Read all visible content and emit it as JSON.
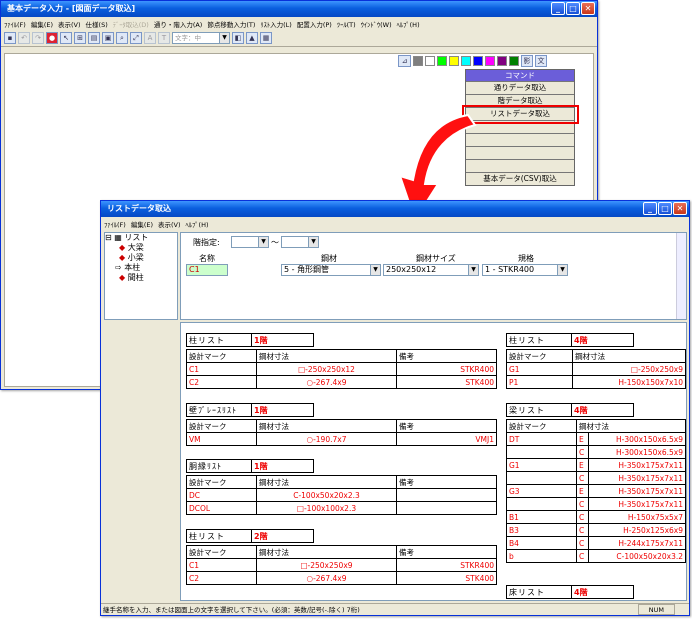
{
  "main_window": {
    "title": "基本データ入力 - [図面データ取込]",
    "menus": [
      "ﾌｧｲﾙ(F)",
      "編集(E)",
      "表示(V)",
      "仕様(S)",
      "ﾃﾞｰﾀ取込(D)",
      "通り・階入力(A)",
      "節点移動入力(T)",
      "ﾘｽﾄ入力(L)",
      "配置入力(P)",
      "ﾂｰﾙ(T)",
      "ｳｲﾝﾄﾞｳ(W)",
      "ﾍﾙﾌﾟ(H)"
    ],
    "disabled_menu": "ﾃﾞｰﾀ取込(D)",
    "text_combo": "文字：中",
    "color_labels": [
      "影",
      "文"
    ],
    "swatches": [
      "#7f7f7f",
      "#ffffff",
      "#00ff00",
      "#ffff00",
      "#00ffff",
      "#0000ff",
      "#ff00ff",
      "#800080",
      "#008000"
    ],
    "command_panel": {
      "header": "コマンド",
      "items": [
        "通りデータ取込",
        "階データ取込",
        "リストデータ取込",
        "",
        "",
        "",
        "",
        "基本データ(CSV)取込"
      ],
      "highlighted": "リストデータ取込"
    }
  },
  "list_window": {
    "title": "リストデータ取込",
    "menus": [
      "ﾌｧｲﾙ(F)",
      "編集(E)",
      "表示(V)",
      "ﾍﾙﾌﾟ(H)"
    ],
    "tree": {
      "root": "リスト",
      "children": [
        "大梁",
        "小梁",
        "本柱",
        "間柱"
      ]
    },
    "form": {
      "floor_label": "階指定:",
      "tilde": "～",
      "name_label": "名称",
      "material_label": "鋼材",
      "size_label": "鋼材サイズ",
      "spec_label": "規格",
      "name_value": "C1",
      "material_value": "5 - 角形鋼管",
      "size_value": "250x250x12",
      "spec_value": "1 - STKR400"
    },
    "sheet": {
      "col_design_mark": "設計マーク",
      "col_size": "鋼材寸法",
      "col_note": "備考",
      "tables_left": [
        {
          "title": "柱リスト",
          "floor": "1階",
          "rows": [
            [
              "C1",
              "□-250x250x12",
              "STKR400"
            ],
            [
              "C2",
              "○-267.4x9",
              "STK400"
            ]
          ]
        },
        {
          "title": "壁ﾌﾞﾚｰｽﾘｽﾄ",
          "floor": "1階",
          "rows": [
            [
              "VM",
              "○-190.7x7",
              "VMJ1"
            ]
          ]
        },
        {
          "title": "胴縁ﾘｽﾄ",
          "floor": "1階",
          "rows": [
            [
              "DC",
              "C-100x50x20x2.3",
              ""
            ],
            [
              "DCOL",
              "□-100x100x2.3",
              ""
            ]
          ]
        },
        {
          "title": "柱リスト",
          "floor": "2階",
          "rows": [
            [
              "C1",
              "□-250x250x9",
              "STKR400"
            ],
            [
              "C2",
              "○-267.4x9",
              "STK400"
            ]
          ]
        }
      ],
      "tables_right": [
        {
          "title": "柱リスト",
          "floor": "4階",
          "rows": [
            [
              "G1",
              "□-250x250x9"
            ],
            [
              "P1",
              "H-150x150x7x10"
            ]
          ]
        },
        {
          "title": "梁リスト",
          "floor": "4階",
          "rows": [
            [
              "DT",
              "E",
              "H-300x150x6.5x9"
            ],
            [
              "",
              "C",
              "H-300x150x6.5x9"
            ],
            [
              "G1",
              "E",
              "H-350x175x7x11"
            ],
            [
              "",
              "C",
              "H-350x175x7x11"
            ],
            [
              "G3",
              "E",
              "H-350x175x7x11"
            ],
            [
              "",
              "C",
              "H-350x175x7x11"
            ],
            [
              "B1",
              "C",
              "H-150x75x5x7"
            ],
            [
              "B3",
              "C",
              "H-250x125x6x9"
            ],
            [
              "B4",
              "C",
              "H-244x175x7x11"
            ],
            [
              "b",
              "C",
              "C-100x50x20x3.2"
            ]
          ]
        },
        {
          "title": "床リスト",
          "floor": "4階",
          "rows": []
        }
      ]
    },
    "status": "継手名称を入力、または図面上の文字を選択して下さい。(必須：英数/記号(-.除く) 7桁)",
    "status_right": "NUM"
  }
}
